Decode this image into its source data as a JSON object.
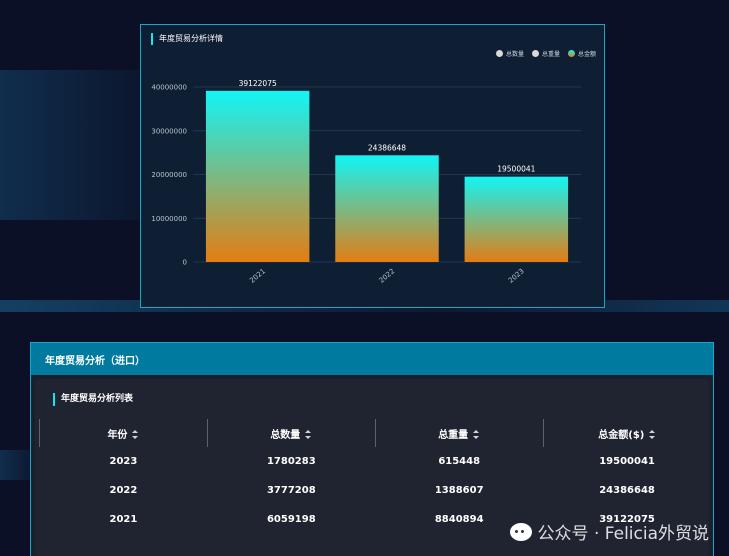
{
  "chart_panel": {
    "title": "年度贸易分析详情",
    "legend": [
      {
        "label": "总数量",
        "color": "#d9d9d9"
      },
      {
        "label": "总重量",
        "color": "#d9d9d9"
      },
      {
        "label": "总金额",
        "color": "#e8a23a"
      }
    ]
  },
  "chart_data": {
    "type": "bar",
    "categories": [
      "2021",
      "2022",
      "2023"
    ],
    "values": [
      39122075,
      24386648,
      19500041
    ],
    "yticks": [
      "0",
      "10000000",
      "20000000",
      "30000000",
      "40000000"
    ],
    "ylim": [
      0,
      40000000
    ],
    "gradient": {
      "top": "#12f5f5",
      "bottom": "#e47d13"
    },
    "grid": true,
    "legend_position": "top-right"
  },
  "table_panel": {
    "title": "年度贸易分析（进口）",
    "subtitle": "年度贸易分析列表",
    "columns": [
      "年份",
      "总数量",
      "总重量",
      "总金额($)"
    ],
    "rows": [
      [
        "2023",
        "1780283",
        "615448",
        "19500041"
      ],
      [
        "2022",
        "3777208",
        "1388607",
        "24386648"
      ],
      [
        "2021",
        "6059198",
        "8840894",
        "39122075"
      ]
    ]
  },
  "watermark": {
    "text": "公众号 · Felicia外贸说"
  }
}
